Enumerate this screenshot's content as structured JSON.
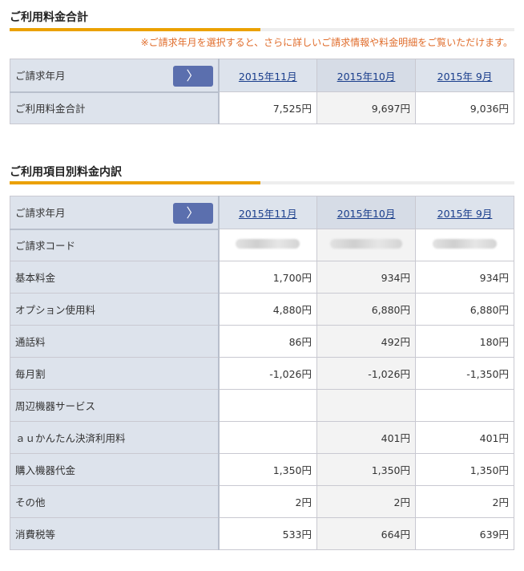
{
  "summary": {
    "title": "ご利用料金合計",
    "note": "※ご請求年月を選択すると、さらに詳しいご請求情報や料金明細をご覧いただけます。",
    "header_label": "ご請求年月",
    "months": [
      "2015年11月",
      "2015年10月",
      "2015年 9月"
    ],
    "rows": [
      {
        "label": "ご利用料金合計",
        "values": [
          "7,525円",
          "9,697円",
          "9,036円"
        ]
      }
    ]
  },
  "breakdown": {
    "title": "ご利用項目別料金内訳",
    "header_label": "ご請求年月",
    "months": [
      "2015年11月",
      "2015年10月",
      "2015年 9月"
    ],
    "code_label": "ご請求コード",
    "rows": [
      {
        "label": "基本料金",
        "values": [
          "1,700円",
          "934円",
          "934円"
        ]
      },
      {
        "label": "オプション使用料",
        "values": [
          "4,880円",
          "6,880円",
          "6,880円"
        ]
      },
      {
        "label": "通話料",
        "values": [
          "86円",
          "492円",
          "180円"
        ]
      },
      {
        "label": "毎月割",
        "values": [
          "-1,026円",
          "-1,026円",
          "-1,350円"
        ]
      },
      {
        "label": "周辺機器サービス",
        "values": [
          "",
          "",
          ""
        ]
      },
      {
        "label": "ａｕかんたん決済利用料",
        "values": [
          "",
          "401円",
          "401円"
        ]
      },
      {
        "label": "購入機器代金",
        "values": [
          "1,350円",
          "1,350円",
          "1,350円"
        ]
      },
      {
        "label": "その他",
        "values": [
          "2円",
          "2円",
          "2円"
        ]
      },
      {
        "label": "消費税等",
        "values": [
          "533円",
          "664円",
          "639円"
        ]
      }
    ]
  },
  "icons": {
    "nav_button": "chevron-right-icon",
    "nav_glyph": "〉"
  },
  "colors": {
    "accent": "#eba100",
    "header_bg": "#dde3ec",
    "button": "#5b6fae",
    "note": "#e06d2c",
    "link": "#1a3e8c"
  }
}
